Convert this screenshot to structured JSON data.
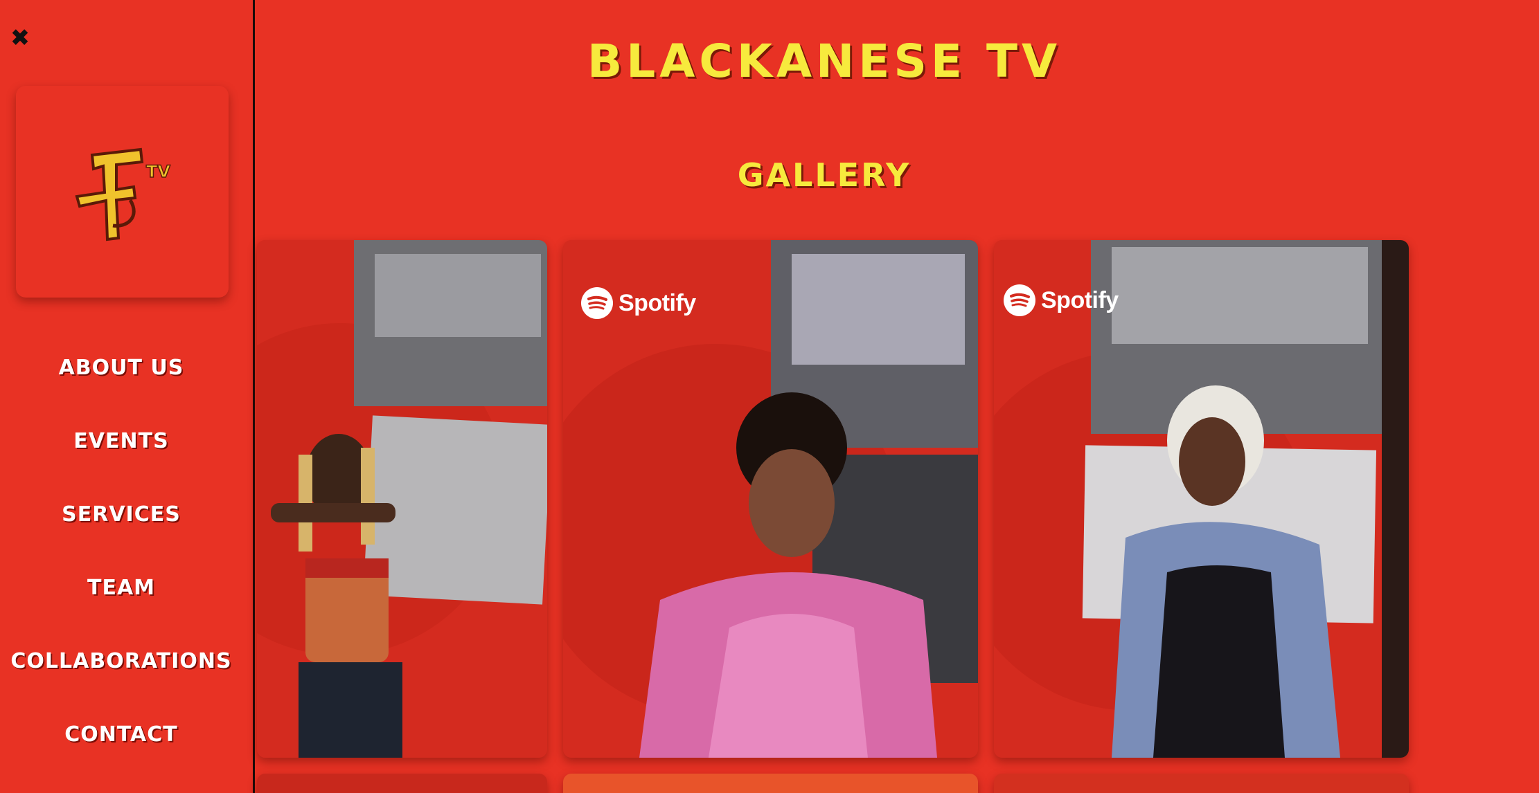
{
  "site": {
    "title": "BLACKANESE TV",
    "logo_text": "TV"
  },
  "sidebar": {
    "close_icon": "close-icon",
    "items": [
      {
        "label": "ABOUT US"
      },
      {
        "label": "EVENTS"
      },
      {
        "label": "SERVICES"
      },
      {
        "label": "TEAM"
      },
      {
        "label": "COLLABORATIONS"
      },
      {
        "label": "CONTACT"
      }
    ]
  },
  "gallery": {
    "title": "GALLERY",
    "cards": [
      {
        "alt": "",
        "badge": ""
      },
      {
        "alt": "",
        "badge": "Spotify"
      },
      {
        "alt": "",
        "badge": "Spotify"
      }
    ]
  },
  "colors": {
    "background": "#e83224",
    "title_yellow": "#f7ea3d",
    "nav_text": "#ffffff"
  }
}
